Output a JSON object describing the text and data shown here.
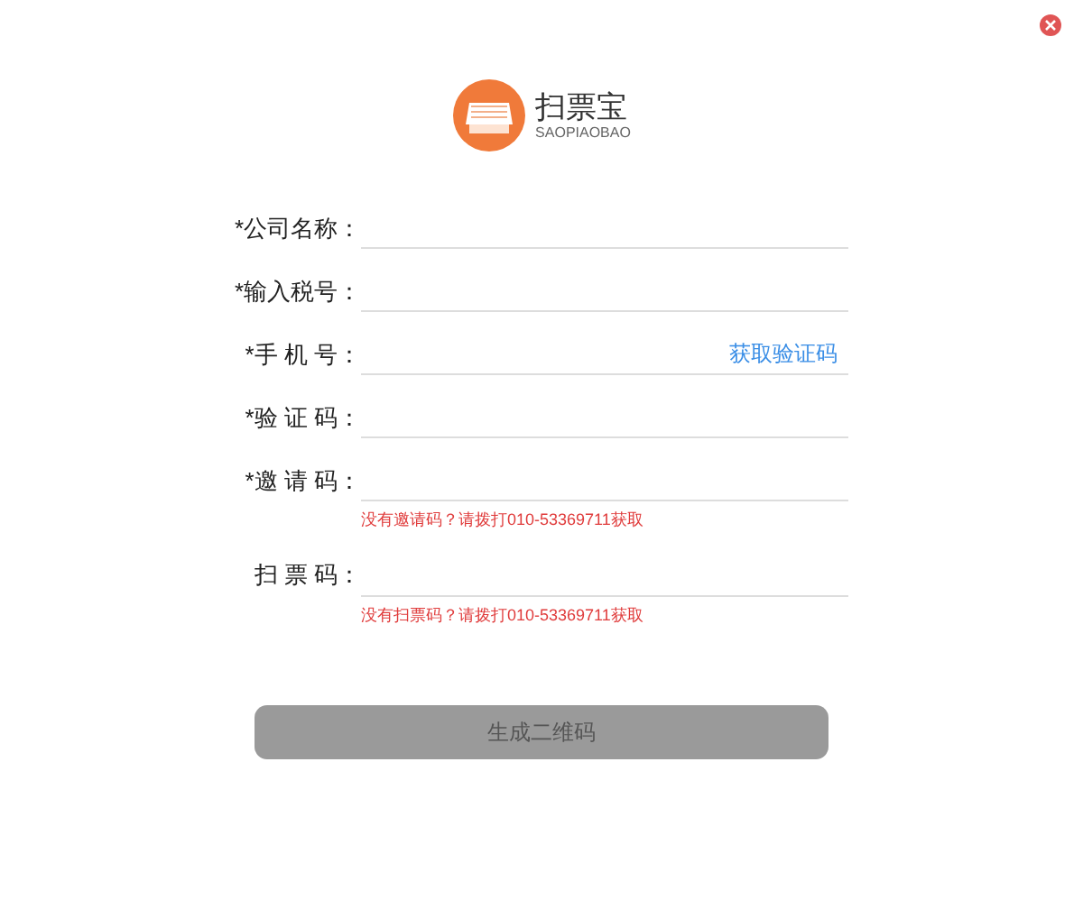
{
  "logo": {
    "title": "扫票宝",
    "subtitle": "SAOPIAOBAO"
  },
  "fields": [
    {
      "label": "*公司名称："
    },
    {
      "label": "*输入税号："
    },
    {
      "label": "*手 机 号：",
      "link": "获取验证码"
    },
    {
      "label": "*验 证 码："
    },
    {
      "label": "*邀 请 码：",
      "hint": "没有邀请码？请拨打010-53369711获取"
    },
    {
      "label": "扫 票 码：",
      "hint": "没有扫票码？请拨打010-53369711获取"
    }
  ],
  "submit": {
    "label": "生成二维码",
    "disabled": true
  }
}
